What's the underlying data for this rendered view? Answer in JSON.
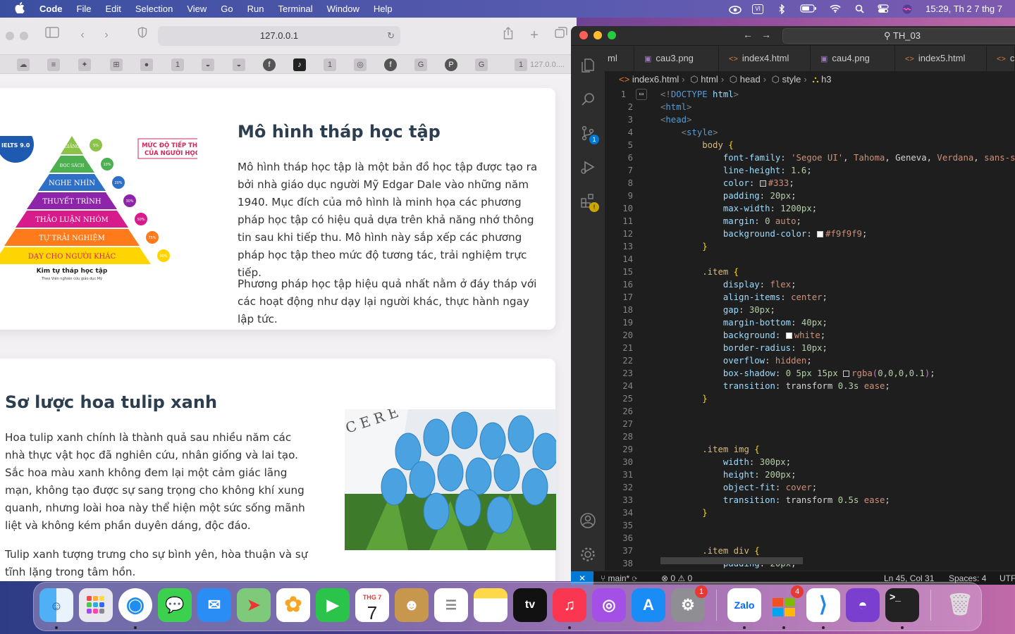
{
  "menubar": {
    "apple": "",
    "items": [
      "Code",
      "File",
      "Edit",
      "Selection",
      "View",
      "Go",
      "Run",
      "Terminal",
      "Window",
      "Help"
    ],
    "clock": "15:29, Th 2 7 thg 7",
    "status_icons": [
      "cloud-sync-icon",
      "input-vi-icon",
      "bluetooth-icon",
      "battery-icon",
      "wifi-icon",
      "spotlight-icon",
      "control-center-icon",
      "siri-icon"
    ],
    "input_label": "VI"
  },
  "safari": {
    "url": "127.0.0.1",
    "last_tab": "127.0.0....",
    "bookmark_labels": [
      "1",
      "1",
      "1"
    ],
    "card1": {
      "title": "Mô hình tháp học tập",
      "para1": "Mô hình tháp học tập là một bản đồ học tập được tạo ra bởi nhà giáo dục người Mỹ Edgar Dale vào những năm 1940. Mục đích của mô hình là minh họa các phương pháp học tập có hiệu quả dựa trên khả năng nhớ thông tin sau khi tiếp thu. Mô hình này sắp xếp các phương pháp học tập theo mức độ tương tác, trải nghiệm trực tiếp.",
      "para2": "Phương pháp học tập hiệu quả nhất nằm ở đáy tháp với các hoạt động như dạy lại người khác, thực hành ngay lập tức.",
      "pyramid": {
        "badge": "IELTS 9.0",
        "heading1": "MỨC ĐỘ TIẾP THU",
        "heading2": "CỦA NGƯỜI HỌC",
        "levels": [
          {
            "label": "GIẢNG",
            "pct": "5%",
            "color": "#8bc34a"
          },
          {
            "label": "ĐỌC SÁCH",
            "pct": "10%",
            "color": "#4caf50"
          },
          {
            "label": "NGHE NHÌN",
            "pct": "20%",
            "color": "#2e6fc8"
          },
          {
            "label": "THUYẾT TRÌNH",
            "pct": "30%",
            "color": "#8e24aa"
          },
          {
            "label": "THẢO LUẬN NHÓM",
            "pct": "50%",
            "color": "#d81b8a"
          },
          {
            "label": "TỰ TRẢI NGHIỆM",
            "pct": "75%",
            "color": "#ff7a1a"
          },
          {
            "label": "DẠY CHO NGƯỜI KHÁC",
            "pct": "90%",
            "color": "#ffd500"
          }
        ],
        "caption": "Kim tự tháp học tập",
        "subcaption": "Theo Viện nghiên cứu giáo dục Mỹ"
      }
    },
    "card2": {
      "title": "Sơ lược hoa tulip xanh",
      "para1": "Hoa tulip xanh chính là thành quả sau nhiều năm các nhà thực vật học đã nghiên cứu, nhân giống và lai tạo. Sắc hoa màu xanh không đem lại một cảm giác lãng mạn, không tạo được sự sang trọng cho không khí xung quanh, nhưng loài hoa này thể hiện một sức sống mãnh liệt và không kém phần duyên dáng, độc đáo.",
      "para2": "Tulip xanh tượng trưng cho sự bình yên, hòa thuận và sự tĩnh lặng trong tâm hồn.",
      "photo_text": "CERE"
    }
  },
  "vscode": {
    "search": "TH_03",
    "tabs": [
      {
        "label": "ml",
        "icon": ""
      },
      {
        "label": "cau3.png",
        "icon": "image-icon"
      },
      {
        "label": "index4.html",
        "icon": "html-icon"
      },
      {
        "label": "cau4.png",
        "icon": "image-icon"
      },
      {
        "label": "index5.html",
        "icon": "html-icon"
      },
      {
        "label": "c",
        "icon": "html-icon"
      }
    ],
    "breadcrumbs": [
      "index6.html",
      "html",
      "head",
      "style",
      "h3"
    ],
    "scm_badge": "1",
    "lines": [
      [
        [
          "t-gr",
          "<!"
        ],
        [
          "t-tag",
          "DOCTYPE"
        ],
        [
          "t-pun",
          " "
        ],
        [
          "t-prop",
          "html"
        ],
        [
          "t-gr",
          ">"
        ]
      ],
      [
        [
          "t-gr",
          "<"
        ],
        [
          "t-tag",
          "html"
        ],
        [
          "t-gr",
          ">"
        ]
      ],
      [
        [
          "t-gr",
          "<"
        ],
        [
          "t-tag",
          "head"
        ],
        [
          "t-gr",
          ">"
        ]
      ],
      [
        [
          "t-pun",
          "    "
        ],
        [
          "t-gr",
          "<"
        ],
        [
          "t-tag",
          "style"
        ],
        [
          "t-gr",
          ">"
        ]
      ],
      [
        [
          "t-pun",
          "        "
        ],
        [
          "t-sel",
          "body"
        ],
        [
          "t-pun",
          " "
        ],
        [
          "t-br",
          "{"
        ]
      ],
      [
        [
          "t-pun",
          "            "
        ],
        [
          "t-prop",
          "font-family"
        ],
        [
          "t-pun",
          ": "
        ],
        [
          "t-val",
          "'Segoe UI'"
        ],
        [
          "t-pun",
          ", "
        ],
        [
          "t-val",
          "Tahoma"
        ],
        [
          "t-pun",
          ", Geneva, "
        ],
        [
          "t-val",
          "Verdana"
        ],
        [
          "t-pun",
          ", "
        ],
        [
          "t-val",
          "sans-serif"
        ]
      ],
      [
        [
          "t-pun",
          "            "
        ],
        [
          "t-prop",
          "line-height"
        ],
        [
          "t-pun",
          ": "
        ],
        [
          "t-num",
          "1.6"
        ],
        [
          "t-pun",
          ";"
        ]
      ],
      [
        [
          "t-pun",
          "            "
        ],
        [
          "t-prop",
          "color"
        ],
        [
          "t-pun",
          ": "
        ],
        [
          "swatch",
          "#333333"
        ],
        [
          "t-val",
          "#333"
        ],
        [
          "t-pun",
          ";"
        ]
      ],
      [
        [
          "t-pun",
          "            "
        ],
        [
          "t-prop",
          "padding"
        ],
        [
          "t-pun",
          ": "
        ],
        [
          "t-num",
          "20px"
        ],
        [
          "t-pun",
          ";"
        ]
      ],
      [
        [
          "t-pun",
          "            "
        ],
        [
          "t-prop",
          "max-width"
        ],
        [
          "t-pun",
          ": "
        ],
        [
          "t-num",
          "1200px"
        ],
        [
          "t-pun",
          ";"
        ]
      ],
      [
        [
          "t-pun",
          "            "
        ],
        [
          "t-prop",
          "margin"
        ],
        [
          "t-pun",
          ": "
        ],
        [
          "t-num",
          "0"
        ],
        [
          "t-pun",
          " "
        ],
        [
          "t-val",
          "auto"
        ],
        [
          "t-pun",
          ";"
        ]
      ],
      [
        [
          "t-pun",
          "            "
        ],
        [
          "t-prop",
          "background-color"
        ],
        [
          "t-pun",
          ": "
        ],
        [
          "swatch",
          "#f9f9f9"
        ],
        [
          "t-val",
          "#f9f9f9"
        ],
        [
          "t-pun",
          ";"
        ]
      ],
      [
        [
          "t-pun",
          "        "
        ],
        [
          "t-br",
          "}"
        ]
      ],
      [],
      [
        [
          "t-pun",
          "        "
        ],
        [
          "t-sel",
          ".item"
        ],
        [
          "t-pun",
          " "
        ],
        [
          "t-br",
          "{"
        ]
      ],
      [
        [
          "t-pun",
          "            "
        ],
        [
          "t-prop",
          "display"
        ],
        [
          "t-pun",
          ": "
        ],
        [
          "t-val",
          "flex"
        ],
        [
          "t-pun",
          ";"
        ]
      ],
      [
        [
          "t-pun",
          "            "
        ],
        [
          "t-prop",
          "align-items"
        ],
        [
          "t-pun",
          ": "
        ],
        [
          "t-val",
          "center"
        ],
        [
          "t-pun",
          ";"
        ]
      ],
      [
        [
          "t-pun",
          "            "
        ],
        [
          "t-prop",
          "gap"
        ],
        [
          "t-pun",
          ": "
        ],
        [
          "t-num",
          "30px"
        ],
        [
          "t-pun",
          ";"
        ]
      ],
      [
        [
          "t-pun",
          "            "
        ],
        [
          "t-prop",
          "margin-bottom"
        ],
        [
          "t-pun",
          ": "
        ],
        [
          "t-num",
          "40px"
        ],
        [
          "t-pun",
          ";"
        ]
      ],
      [
        [
          "t-pun",
          "            "
        ],
        [
          "t-prop",
          "background"
        ],
        [
          "t-pun",
          ": "
        ],
        [
          "swatch",
          "#ffffff"
        ],
        [
          "t-val",
          "white"
        ],
        [
          "t-pun",
          ";"
        ]
      ],
      [
        [
          "t-pun",
          "            "
        ],
        [
          "t-prop",
          "border-radius"
        ],
        [
          "t-pun",
          ": "
        ],
        [
          "t-num",
          "10px"
        ],
        [
          "t-pun",
          ";"
        ]
      ],
      [
        [
          "t-pun",
          "            "
        ],
        [
          "t-prop",
          "overflow"
        ],
        [
          "t-pun",
          ": "
        ],
        [
          "t-val",
          "hidden"
        ],
        [
          "t-pun",
          ";"
        ]
      ],
      [
        [
          "t-pun",
          "            "
        ],
        [
          "t-prop",
          "box-shadow"
        ],
        [
          "t-pun",
          ": "
        ],
        [
          "t-num",
          "0 5px 15px"
        ],
        [
          "t-pun",
          " "
        ],
        [
          "swatch",
          "#1e1e1e"
        ],
        [
          "t-val",
          "rgba"
        ],
        [
          "t-br2",
          "("
        ],
        [
          "t-num",
          "0,0,0,0.1"
        ],
        [
          "t-br2",
          ")"
        ],
        [
          "t-pun",
          ";"
        ]
      ],
      [
        [
          "t-pun",
          "            "
        ],
        [
          "t-prop",
          "transition"
        ],
        [
          "t-pun",
          ": transform "
        ],
        [
          "t-num",
          "0.3s"
        ],
        [
          "t-pun",
          " "
        ],
        [
          "t-val",
          "ease"
        ],
        [
          "t-pun",
          ";"
        ]
      ],
      [
        [
          "t-pun",
          "        "
        ],
        [
          "t-br",
          "}"
        ]
      ],
      [],
      [],
      [],
      [
        [
          "t-pun",
          "        "
        ],
        [
          "t-sel",
          ".item img"
        ],
        [
          "t-pun",
          " "
        ],
        [
          "t-br",
          "{"
        ]
      ],
      [
        [
          "t-pun",
          "            "
        ],
        [
          "t-prop",
          "width"
        ],
        [
          "t-pun",
          ": "
        ],
        [
          "t-num",
          "300px"
        ],
        [
          "t-pun",
          ";"
        ]
      ],
      [
        [
          "t-pun",
          "            "
        ],
        [
          "t-prop",
          "height"
        ],
        [
          "t-pun",
          ": "
        ],
        [
          "t-num",
          "200px"
        ],
        [
          "t-pun",
          ";"
        ]
      ],
      [
        [
          "t-pun",
          "            "
        ],
        [
          "t-prop",
          "object-fit"
        ],
        [
          "t-pun",
          ": "
        ],
        [
          "t-val",
          "cover"
        ],
        [
          "t-pun",
          ";"
        ]
      ],
      [
        [
          "t-pun",
          "            "
        ],
        [
          "t-prop",
          "transition"
        ],
        [
          "t-pun",
          ": transform "
        ],
        [
          "t-num",
          "0.5s"
        ],
        [
          "t-pun",
          " "
        ],
        [
          "t-val",
          "ease"
        ],
        [
          "t-pun",
          ";"
        ]
      ],
      [
        [
          "t-pun",
          "        "
        ],
        [
          "t-br",
          "}"
        ]
      ],
      [],
      [],
      [
        [
          "t-pun",
          "        "
        ],
        [
          "t-sel",
          ".item div"
        ],
        [
          "t-pun",
          " "
        ],
        [
          "t-br",
          "{"
        ]
      ],
      [
        [
          "t-pun",
          "            "
        ],
        [
          "t-prop",
          "padding"
        ],
        [
          "t-pun",
          ": "
        ],
        [
          "t-num",
          "20px"
        ],
        [
          "t-pun",
          ";"
        ]
      ]
    ],
    "status": {
      "branch": "main*",
      "problems": "⊗ 0 ⚠ 0",
      "cursor": "Ln 45, Col 31",
      "spaces": "Spaces: 4",
      "encoding": "UTF"
    }
  },
  "dock": {
    "calendar_month": "THG 7",
    "calendar_day": "7",
    "tv_label": "tv",
    "zalo_label": "Zalo",
    "settings_badge": "1",
    "msstore_badge": "4",
    "apps": [
      "finder-icon",
      "launchpad-icon",
      "safari-icon",
      "messages-icon",
      "mail-icon",
      "maps-icon",
      "photos-icon",
      "facetime-icon",
      "calendar-icon",
      "contacts-icon",
      "reminders-icon",
      "notes-icon",
      "appletv-icon",
      "music-icon",
      "podcasts-icon",
      "appstore-icon",
      "settings-icon",
      "zalo-icon",
      "msstore-icon",
      "vscode-icon",
      "github-icon",
      "terminal-icon",
      "trash-icon"
    ]
  }
}
